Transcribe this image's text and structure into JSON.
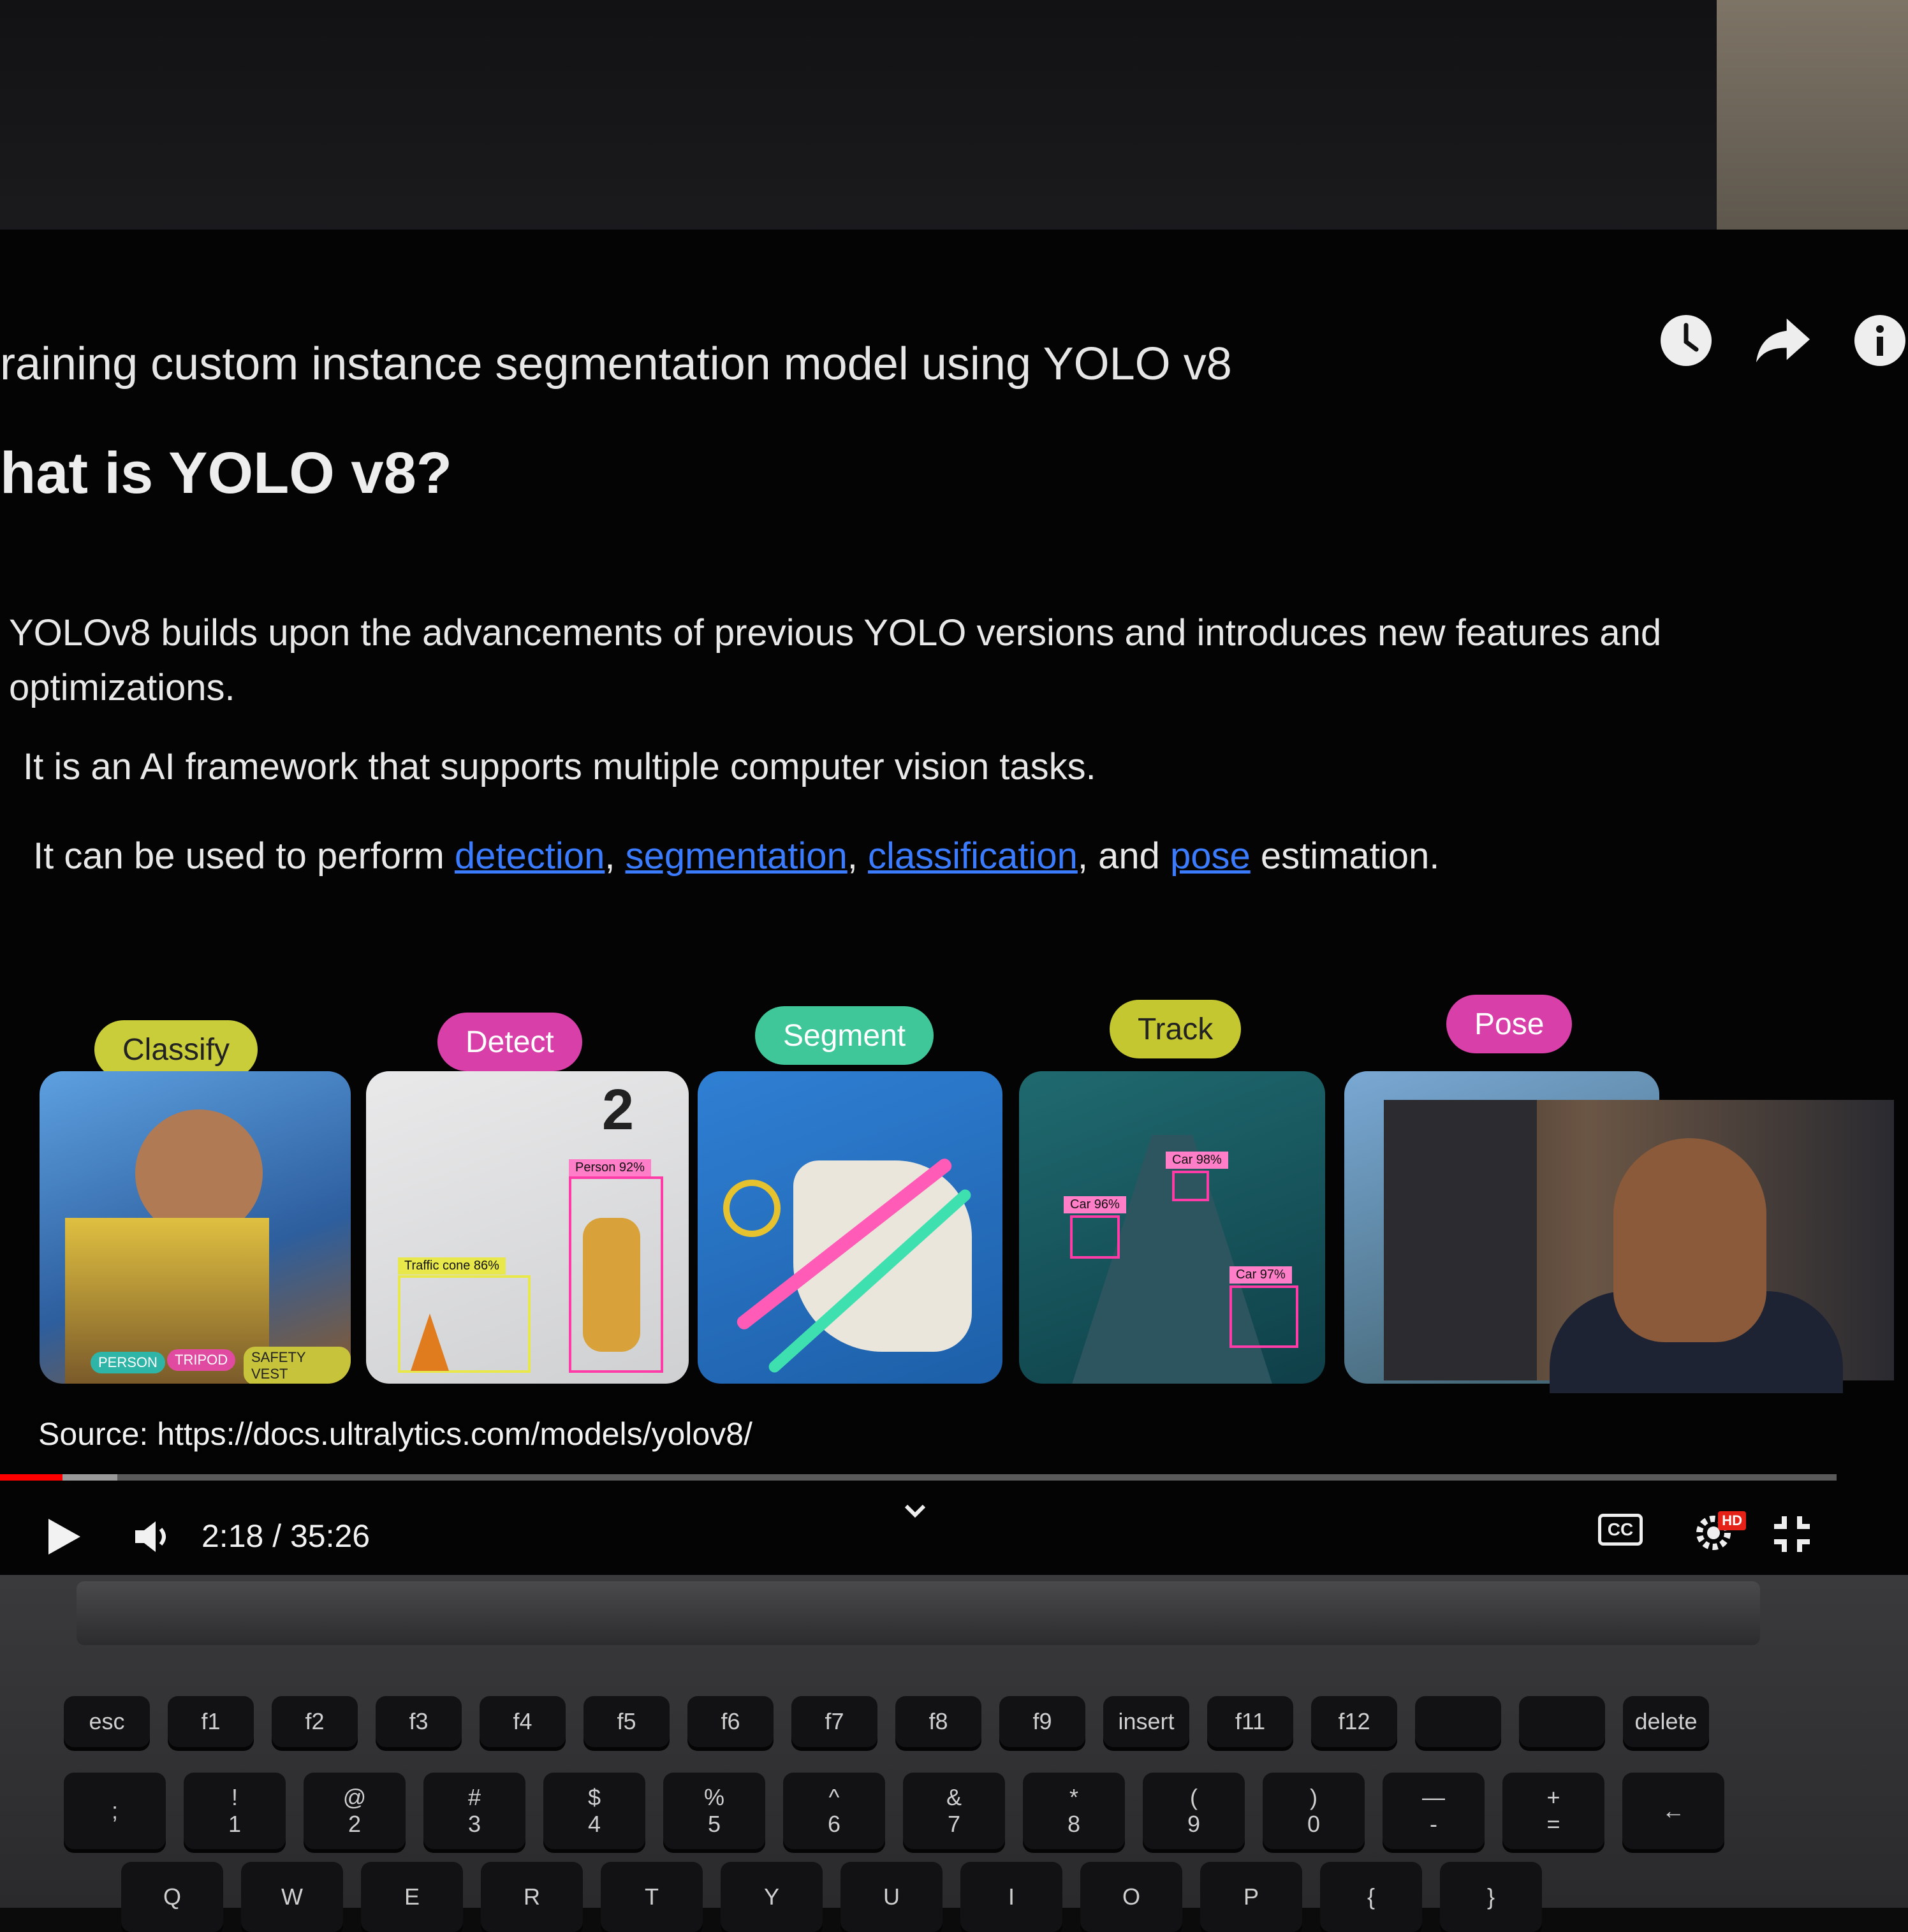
{
  "video": {
    "title": "raining custom instance segmentation model using YOLO v8",
    "heading": "hat is YOLO v8?",
    "paragraph1": "YOLOv8 builds upon the advancements of previous YOLO versions and introduces new features and optimizations.",
    "paragraph2": "It is an AI framework that supports multiple computer vision tasks.",
    "paragraph3_prefix": "It can be used to perform ",
    "links": {
      "detection": "detection",
      "segmentation": "segmentation",
      "classification": "classification",
      "pose": "pose"
    },
    "comma1": ", ",
    "comma2": ", ",
    "and_text": ", and ",
    "paragraph3_suffix": " estimation.",
    "source": "Source: https://docs.ultralytics.com/models/yolov8/"
  },
  "tasks": {
    "classify": {
      "label": "Classify",
      "color": "#c9cd3a"
    },
    "detect": {
      "label": "Detect",
      "color": "#d83fa9"
    },
    "segment": {
      "label": "Segment",
      "color": "#3fc79a"
    },
    "track": {
      "label": "Track",
      "color": "#c4c72f"
    },
    "pose": {
      "label": "Pose",
      "color": "#d83fa9"
    }
  },
  "cards": {
    "classify_tags": [
      "PERSON",
      "TRIPOD",
      "SAFETY VEST"
    ],
    "detect_labels": {
      "person": "Person 92%",
      "cone": "Traffic cone 86%",
      "sign": "2"
    },
    "track_labels": {
      "car1": "Car 98%",
      "car2": "Car 96%",
      "car3": "Car 97%"
    }
  },
  "player": {
    "time": "2:18 / 35:26",
    "progress_played": 0.034,
    "progress_buffered": 0.064,
    "hd_badge": "HD",
    "cc_label": "CC"
  },
  "keyboard": {
    "fn_row": [
      "esc",
      "f1",
      "f2",
      "f3",
      "f4",
      "f5",
      "f6",
      "f7",
      "f8",
      "f9",
      "insert",
      "f11",
      "f12",
      "",
      "",
      "delete"
    ],
    "num_row": [
      [
        "",
        ";"
      ],
      [
        "!",
        "1"
      ],
      [
        "@",
        "2"
      ],
      [
        "#",
        "3"
      ],
      [
        "$",
        "4"
      ],
      [
        "%",
        "5"
      ],
      [
        "^",
        "6"
      ],
      [
        "&",
        "7"
      ],
      [
        "*",
        "8"
      ],
      [
        "(",
        "9"
      ],
      [
        ")",
        "0"
      ],
      [
        "—",
        "-"
      ],
      [
        "+",
        "="
      ],
      [
        "←",
        ""
      ]
    ],
    "alpha_row": [
      "Q",
      "W",
      "E",
      "R",
      "T",
      "Y",
      "U",
      "I",
      "O",
      "P",
      "{",
      "}"
    ]
  }
}
